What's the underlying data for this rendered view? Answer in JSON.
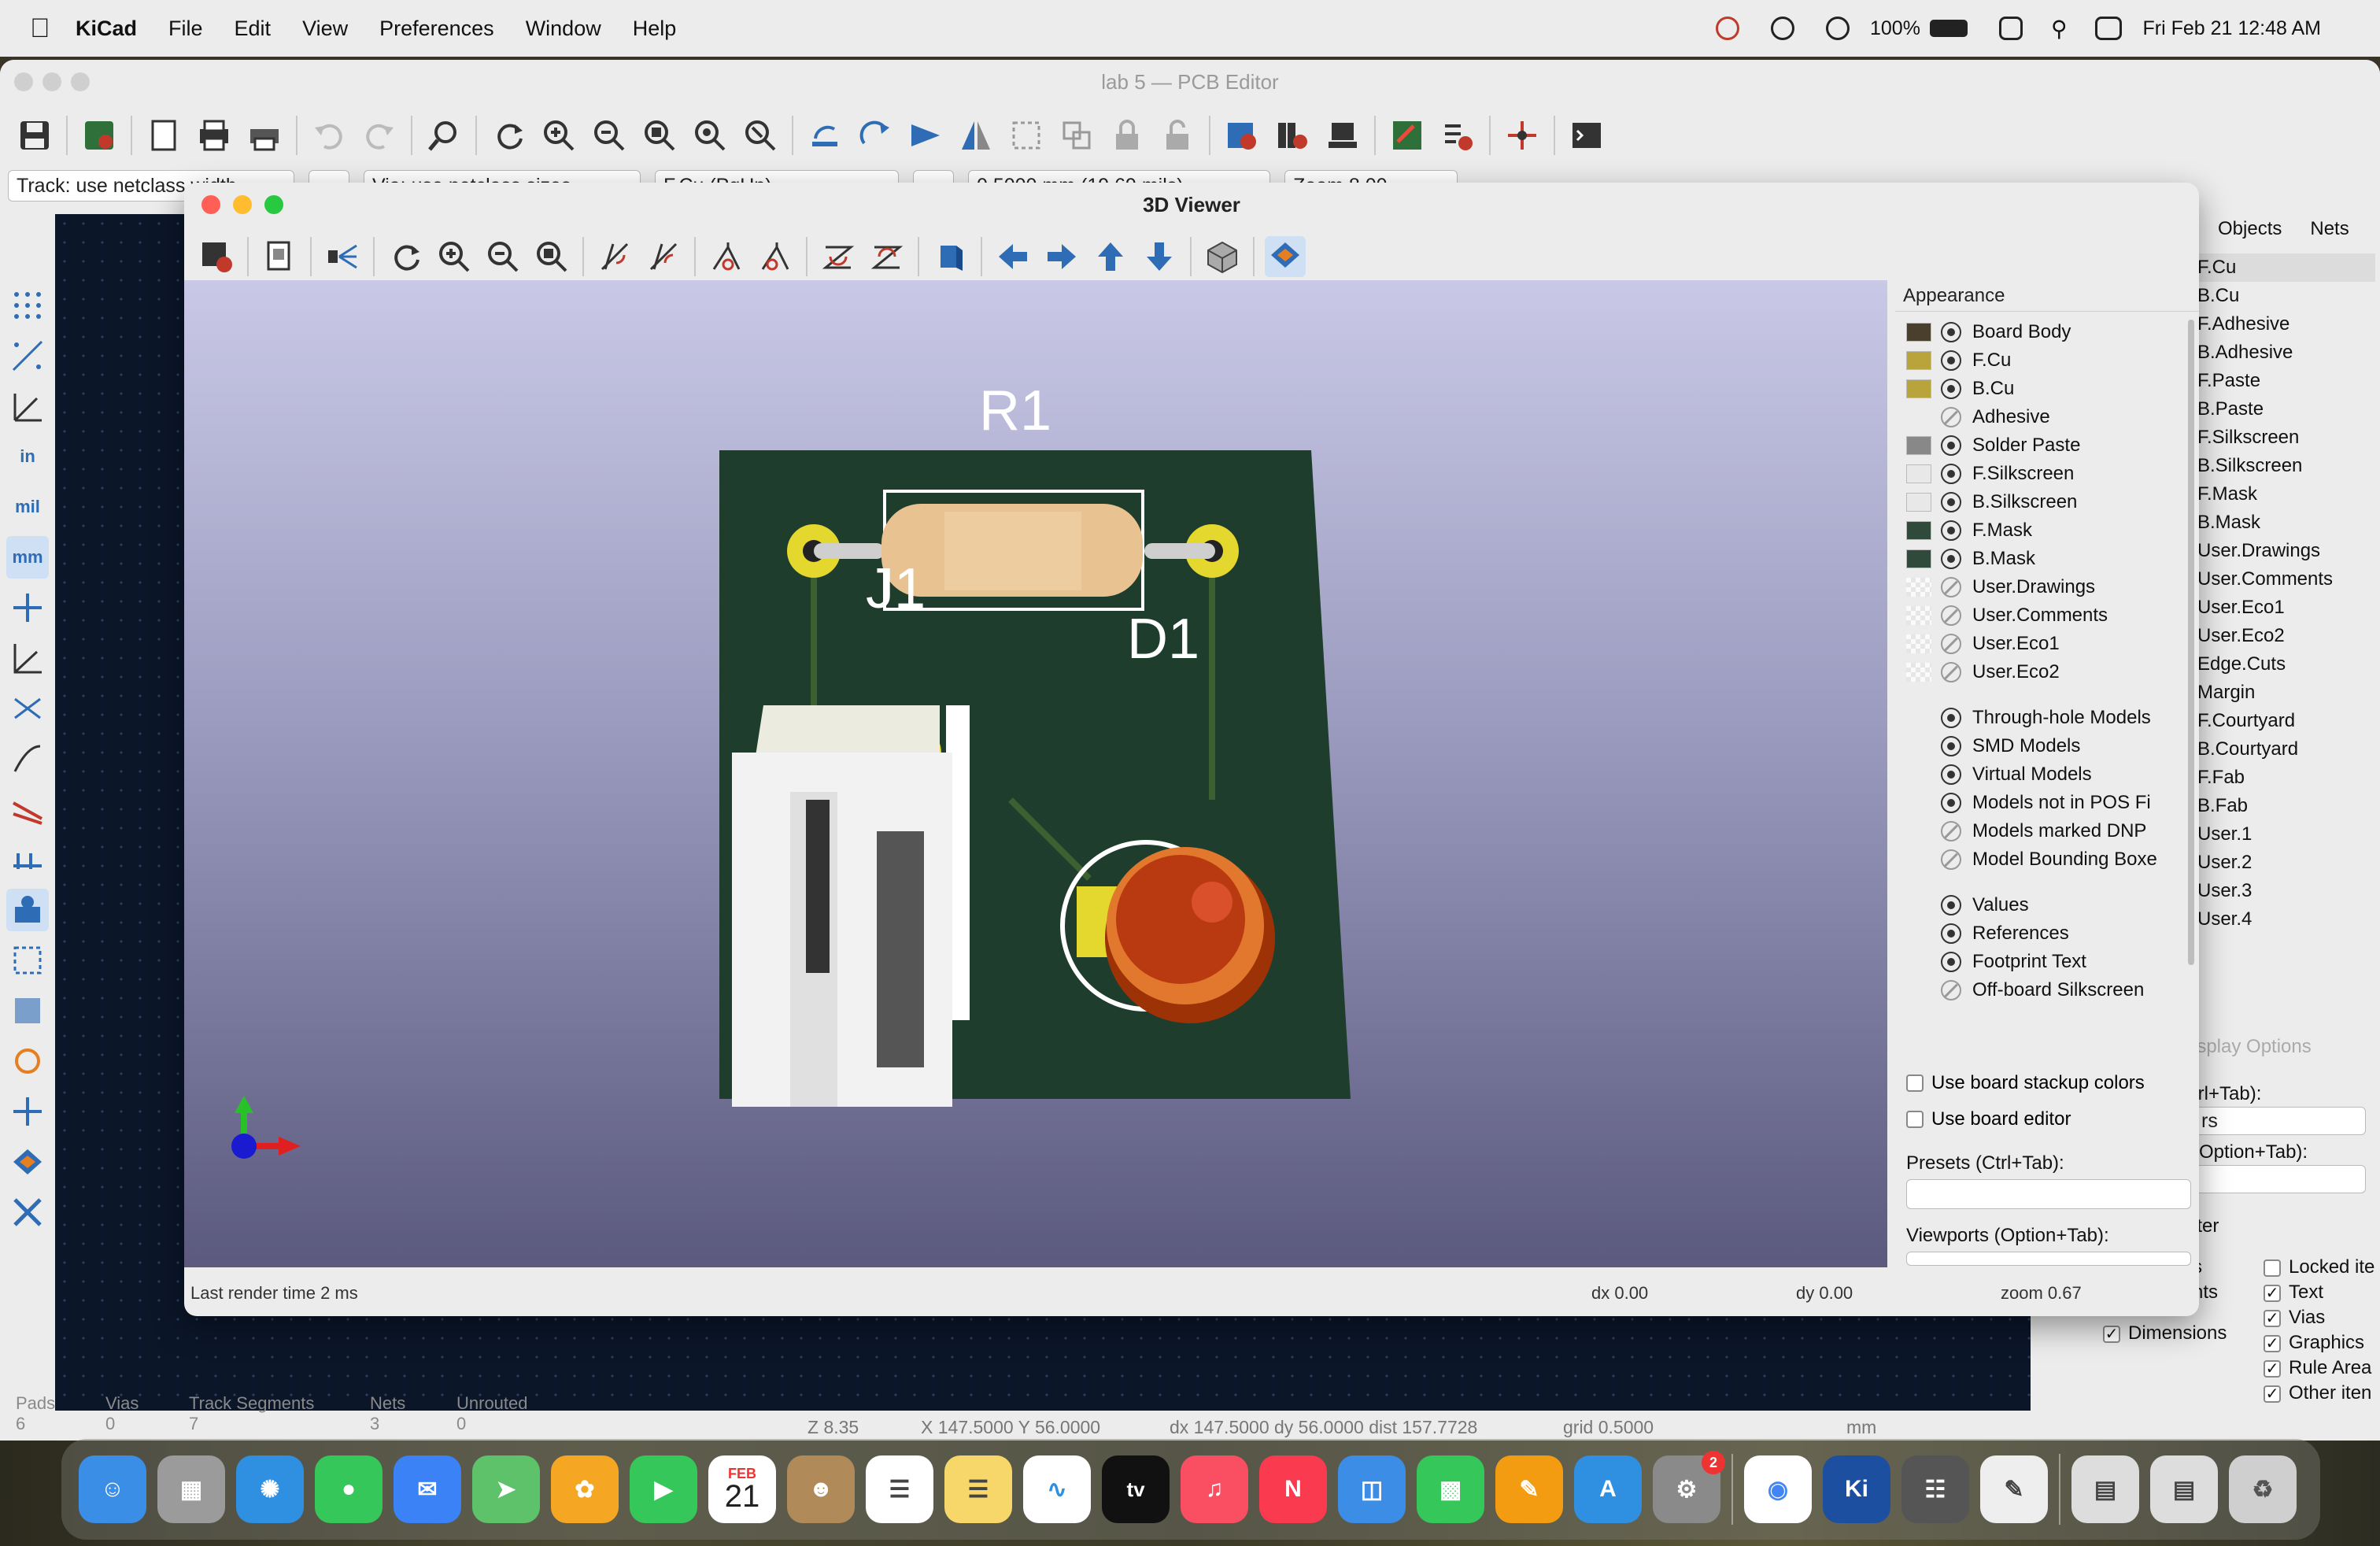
{
  "menubar": {
    "app": "KiCad",
    "items": [
      "File",
      "Edit",
      "View",
      "Preferences",
      "Window",
      "Help"
    ],
    "battery": "100%",
    "clock": "Fri Feb 21  12:48 AM"
  },
  "main": {
    "title": "lab 5 — PCB Editor",
    "track_combo": "Track: use netclass width",
    "via_combo": "Via: use netclass sizes",
    "layer_combo": "F.Cu (PgUp)",
    "grid_combo": "0.5000 mm (19.69 mils)",
    "zoom_combo": "Zoom 8.00",
    "left_units": [
      "in",
      "mil",
      "mm"
    ],
    "right_tabs": [
      "Objects",
      "Nets"
    ],
    "right_layers": [
      "F.Cu",
      "B.Cu",
      "F.Adhesive",
      "B.Adhesive",
      "F.Paste",
      "B.Paste",
      "F.Silkscreen",
      "B.Silkscreen",
      "F.Mask",
      "B.Mask",
      "User.Drawings",
      "User.Comments",
      "User.Eco1",
      "User.Eco2",
      "Edge.Cuts",
      "Margin",
      "F.Courtyard",
      "B.Courtyard",
      "F.Fab",
      "B.Fab",
      "User.1",
      "User.2",
      "User.3",
      "User.4"
    ],
    "display_options": "isplay Options",
    "presets_label": "trl+Tab):",
    "presets_value": "rs",
    "viewports_label": "(Option+Tab):",
    "filter_label": "lter",
    "filter_left": [
      "s",
      "nts"
    ],
    "filter_items": [
      "Locked ite",
      "Text",
      "Vias",
      "Graphics",
      "Rule Area",
      "Other iten"
    ],
    "dimensions": "Dimensions",
    "stats": {
      "labels": [
        "Pads",
        "Vias",
        "Track Segments",
        "Nets",
        "Unrouted"
      ],
      "values": [
        "6",
        "0",
        "7",
        "3",
        "0"
      ]
    },
    "coords": {
      "z": "Z 8.35",
      "xy": "X 147.5000  Y 56.0000",
      "dxy": "dx 147.5000  dy 56.0000  dist 157.7728",
      "grid": "grid 0.5000",
      "units": "mm"
    }
  },
  "viewer": {
    "title": "3D Viewer",
    "board_labels": [
      "R1",
      "J1",
      "D1"
    ],
    "appearance_title": "Appearance",
    "layers": [
      {
        "name": "Board Body",
        "color": "#4a3f2c",
        "visible": true
      },
      {
        "name": "F.Cu",
        "color": "#b8a43a",
        "visible": true
      },
      {
        "name": "B.Cu",
        "color": "#b8a43a",
        "visible": true
      },
      {
        "name": "Adhesive",
        "color": "",
        "visible": false
      },
      {
        "name": "Solder Paste",
        "color": "#888888",
        "visible": true
      },
      {
        "name": "F.Silkscreen",
        "color": "#e8e8e8",
        "visible": true
      },
      {
        "name": "B.Silkscreen",
        "color": "#e8e8e8",
        "visible": true
      },
      {
        "name": "F.Mask",
        "color": "#2f4a3a",
        "visible": true
      },
      {
        "name": "B.Mask",
        "color": "#2f4a3a",
        "visible": true
      },
      {
        "name": "User.Drawings",
        "color": "checker",
        "visible": false
      },
      {
        "name": "User.Comments",
        "color": "checker",
        "visible": false
      },
      {
        "name": "User.Eco1",
        "color": "checker",
        "visible": false
      },
      {
        "name": "User.Eco2",
        "color": "checker",
        "visible": false
      }
    ],
    "models": [
      {
        "name": "Through-hole Models",
        "visible": true
      },
      {
        "name": "SMD Models",
        "visible": true
      },
      {
        "name": "Virtual Models",
        "visible": true
      },
      {
        "name": "Models not in POS Fi",
        "visible": true
      },
      {
        "name": "Models marked DNP",
        "visible": false
      },
      {
        "name": "Model Bounding Boxe",
        "visible": false
      }
    ],
    "texts": [
      {
        "name": "Values",
        "visible": true
      },
      {
        "name": "References",
        "visible": true
      },
      {
        "name": "Footprint Text",
        "visible": true
      },
      {
        "name": "Off-board Silkscreen",
        "visible": false
      }
    ],
    "use_stackup": "Use board stackup colors",
    "use_editor": "Use board editor",
    "presets_label": "Presets (Ctrl+Tab):",
    "viewports_label": "Viewports (Option+Tab):",
    "render_time": "Last render time 2 ms",
    "dx": "dx 0.00",
    "dy": "dy 0.00",
    "zoom": "zoom 0.67"
  },
  "dock": [
    "Finder",
    "Launchpad",
    "Safari",
    "Messages",
    "Mail",
    "Maps",
    "Photos",
    "FaceTime",
    "Calendar",
    "Contacts",
    "Reminders",
    "Notes",
    "Freeform",
    "TV",
    "Music",
    "News",
    "Keynote",
    "Numbers",
    "Pages",
    "App Store",
    "System Settings",
    "Chrome",
    "KiCad",
    "PCB Calculator",
    "TextEdit",
    "Preview",
    "Downloads",
    "Trash"
  ],
  "calendar_day": "21",
  "calendar_month": "FEB",
  "settings_badge": "2"
}
